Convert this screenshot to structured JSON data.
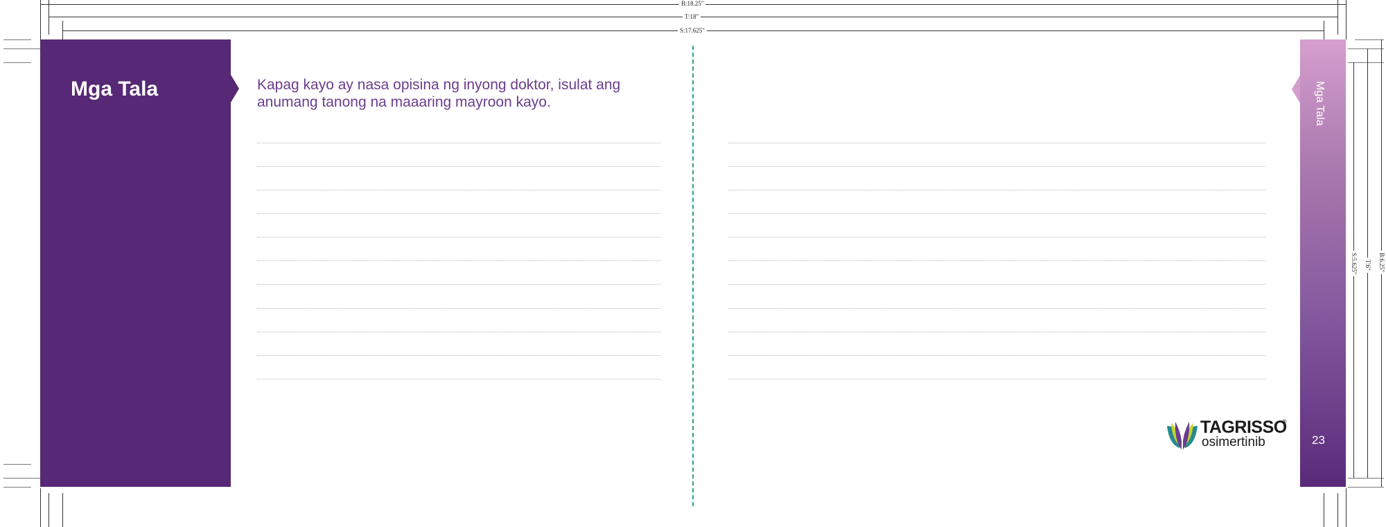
{
  "dimensions": {
    "bleed_width": "B:18.25\"",
    "trim_width": "T:18\"",
    "safety_width": "S:17.625\"",
    "bleed_height": "B:6.25\"",
    "trim_height": "T:6\"",
    "safety_height": "S:5.625\""
  },
  "left_page": {
    "tab_title": "Mga Tala",
    "instruction": "Kapag kayo ay nasa opisina ng inyong doktor, isulat ang anumang tanong na maaaring mayroon kayo."
  },
  "right_page": {
    "tab_title": "Mga Tala",
    "page_number": "23"
  },
  "logo": {
    "brand": "TAGRISSO",
    "registered": "®",
    "generic": "osimertinib"
  },
  "colors": {
    "purple": "#572876",
    "tab_gradient_top": "#d59fce",
    "fold_dash": "#2ea37c",
    "instruction_text": "#6a3d8c"
  }
}
